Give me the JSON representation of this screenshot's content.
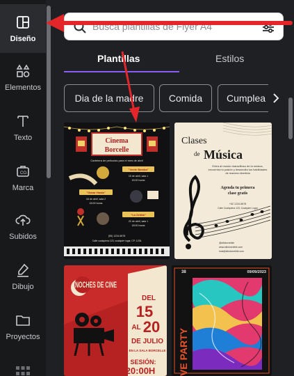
{
  "sidebar": {
    "items": [
      {
        "label": "Diseño",
        "icon": "layout-icon",
        "active": true
      },
      {
        "label": "Elementos",
        "icon": "shapes-icon"
      },
      {
        "label": "Texto",
        "icon": "text-icon"
      },
      {
        "label": "Marca",
        "icon": "brand-icon"
      },
      {
        "label": "Subidos",
        "icon": "cloud-upload-icon"
      },
      {
        "label": "Dibujo",
        "icon": "pen-icon"
      },
      {
        "label": "Proyectos",
        "icon": "folder-icon"
      }
    ]
  },
  "search": {
    "placeholder": "Busca plantillas de Flyer A4",
    "value": ""
  },
  "tabs": [
    {
      "label": "Plantillas",
      "active": true
    },
    {
      "label": "Estilos"
    }
  ],
  "chips": [
    "Dia de la madre",
    "Comida",
    "Cumplea"
  ],
  "templates": {
    "t1": {
      "title1": "Cinema",
      "title2": "Borcelle",
      "subtitle": "Cartelera de películas para el mes de abril",
      "movie1": "\"Verde Bamba\"",
      "movie2": "\"Ganar Hasta\"",
      "movie3": "\"La Orbita\"",
      "date1": "15 de abril, sala 1",
      "time1": "15:00 horas",
      "date2": "18 de abril, sala 2",
      "time2": "16:00 horas",
      "date3": "22 de abril, sala 1",
      "time3": "18:00 horas",
      "phone": "(55) 1234-5678",
      "address": "Calle cualquiera 123, cualquier lugar, CP: 1234"
    },
    "t2": {
      "title1": "Clases",
      "title2": "de",
      "title3": "Música",
      "body": "Entra al mundo maravilloso de la música, encuentra tu pasión y desarrolla tus habilidades de manera divertida",
      "cta1": "Agenda tu primera",
      "cta2": "clase gratis",
      "phone": "+52 1234-5678",
      "address": "Calle Cualquiera 123, Cualquier Lugar",
      "handle": "@sitioincreible",
      "web": "www.sitioincreible.com",
      "email": "hola@sitioincreible.com"
    },
    "t3": {
      "title": "NOCHES DE CINE",
      "del": "DEL",
      "d1": "15",
      "al": "AL",
      "d2": "20",
      "month": "DE JULIO",
      "venue": "EN LA SALA BORCELLE",
      "session_label": "SESIÓN:",
      "session_time": "20:00H"
    },
    "t4": {
      "vertical": "VE PARTY",
      "number": "38",
      "date": "09/09/2023"
    }
  },
  "colors": {
    "accent": "#8b5cf6",
    "annotation": "#e3262a"
  }
}
